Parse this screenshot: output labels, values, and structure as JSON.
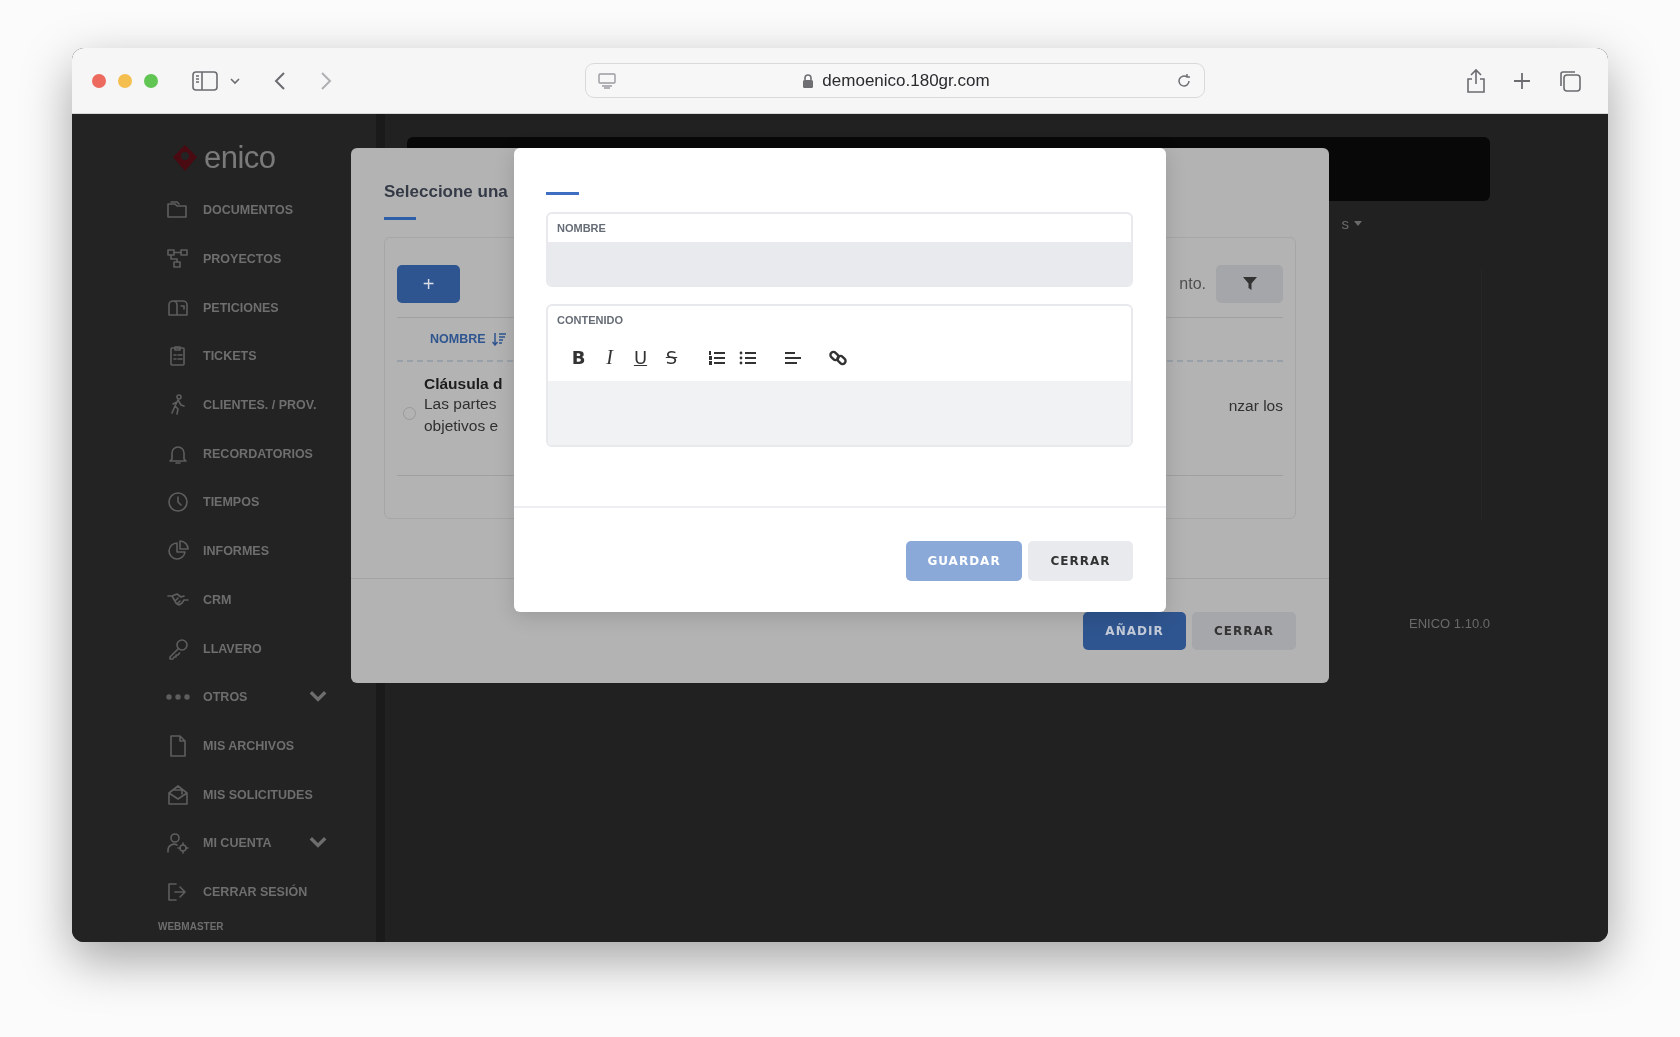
{
  "browser": {
    "url": "demoenico.180gr.com"
  },
  "sidebar": {
    "logo": "enico",
    "items": [
      {
        "label": "DOCUMENTOS",
        "submenu": false
      },
      {
        "label": "PROYECTOS",
        "submenu": false
      },
      {
        "label": "PETICIONES",
        "submenu": false
      },
      {
        "label": "TICKETS",
        "submenu": false
      },
      {
        "label": "CLIENTES. / PROV.",
        "submenu": false
      },
      {
        "label": "RECORDATORIOS",
        "submenu": false
      },
      {
        "label": "TIEMPOS",
        "submenu": false
      },
      {
        "label": "INFORMES",
        "submenu": false
      },
      {
        "label": "CRM",
        "submenu": false
      },
      {
        "label": "LLAVERO",
        "submenu": false
      },
      {
        "label": "OTROS",
        "submenu": true
      },
      {
        "label": "MIS ARCHIVOS",
        "submenu": false
      },
      {
        "label": "MIS SOLICITUDES",
        "submenu": false
      },
      {
        "label": "MI CUENTA",
        "submenu": true
      },
      {
        "label": "CERRAR SESIÓN",
        "submenu": false
      }
    ],
    "user": "WEBMASTER"
  },
  "background": {
    "menu_fragment": "s",
    "version": "ENICO 1.10.0"
  },
  "select_dialog": {
    "title": "Seleccione una",
    "add_button": "+",
    "search_fragment": "nto.",
    "column_header": "NOMBRE",
    "rows": [
      {
        "title": "Cláusula d",
        "lines": [
          "Las partes",
          "objetivos e"
        ],
        "right_fragment": "nzar los",
        "selected": false
      }
    ],
    "buttons": [
      {
        "label": "AÑADIR",
        "kind": "primary"
      },
      {
        "label": "CERRAR",
        "kind": "secondary"
      }
    ]
  },
  "edit_dialog": {
    "fields": [
      {
        "label": "NOMBRE",
        "kind": "input"
      },
      {
        "label": "CONTENIDO",
        "kind": "rich-text",
        "toolbar": [
          {
            "kind": "bold",
            "label": "B"
          },
          {
            "kind": "italic",
            "label": "I"
          },
          {
            "kind": "underline",
            "label": "U"
          },
          {
            "kind": "strike",
            "label": "S"
          },
          {
            "kind": "ordered-list"
          },
          {
            "kind": "bullet-list"
          },
          {
            "kind": "align-left"
          },
          {
            "kind": "link"
          }
        ]
      }
    ],
    "buttons": [
      {
        "label": "GUARDAR",
        "kind": "primary",
        "disabled": true
      },
      {
        "label": "CERRAR",
        "kind": "secondary",
        "disabled": false
      }
    ]
  }
}
